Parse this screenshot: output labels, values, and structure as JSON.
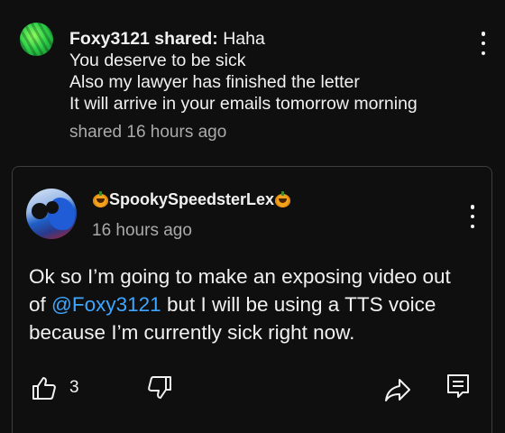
{
  "share_post": {
    "username": "Foxy3121 shared:",
    "message_lines": [
      "Haha",
      "You deserve to be sick",
      "Also my lawyer has finished the letter",
      "It will arrive in your emails tomorrow morning"
    ],
    "meta": "shared 16 hours ago",
    "avatar_icon": "green-pattern-avatar",
    "menu_icon": "more-vertical-icon"
  },
  "comment": {
    "author": "SpookySpeedsterLex",
    "author_decorations": [
      "jack-o-lantern-emoji",
      "jack-o-lantern-emoji"
    ],
    "time": "16 hours ago",
    "body_lines": {
      "line1": "Ok so I’m going to make an exposing video out",
      "line2_prefix": "of ",
      "mention": "@Foxy3121",
      "line2_suffix": " but I will be using a TTS voice",
      "line3": "because I’m currently sick right now."
    },
    "like_count": "3",
    "icons": {
      "like": "thumbs-up-icon",
      "dislike": "thumbs-down-icon",
      "share": "share-arrow-icon",
      "reply": "reply-comment-icon",
      "menu": "more-vertical-icon"
    }
  },
  "colors": {
    "background": "#0f0f0f",
    "text": "#f1f1f1",
    "secondary_text": "#aaaaaa",
    "mention": "#3ea6ff",
    "card_border": "#3d3d3d"
  }
}
